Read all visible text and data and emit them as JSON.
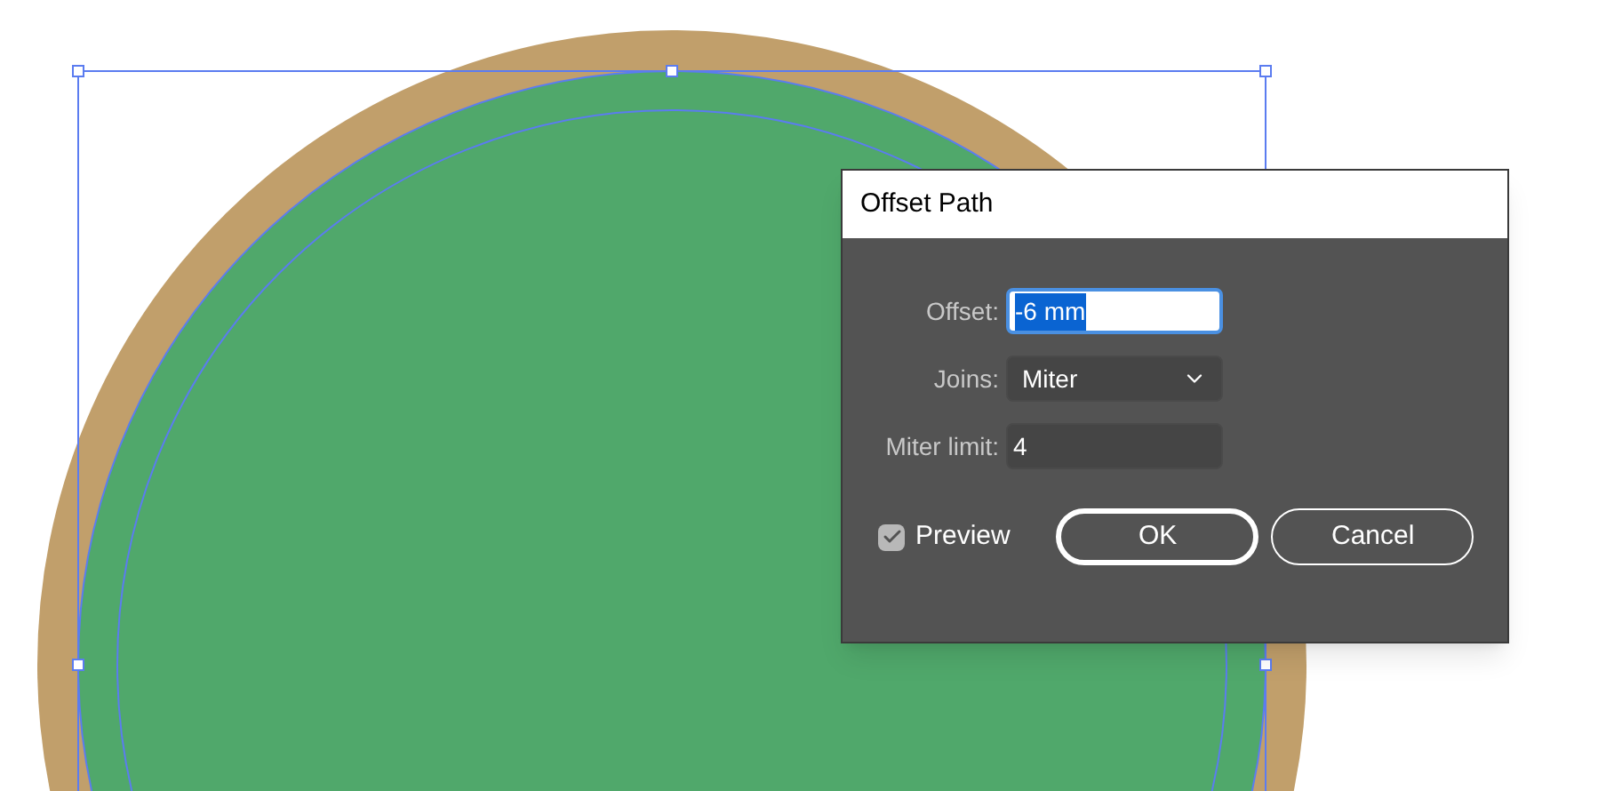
{
  "dialog": {
    "title": "Offset Path",
    "fields": [
      {
        "kind": "text",
        "label": "Offset:",
        "value": "-6 mm",
        "selected": true,
        "focused": true
      },
      {
        "kind": "dropdown",
        "label": "Joins:",
        "value": "Miter"
      },
      {
        "kind": "text",
        "label": "Miter limit:",
        "value": "4",
        "selected": false,
        "focused": false
      }
    ],
    "preview": {
      "label": "Preview",
      "checked": true
    },
    "buttons": [
      {
        "label": "OK",
        "default": true
      },
      {
        "label": "Cancel",
        "default": false
      }
    ]
  }
}
